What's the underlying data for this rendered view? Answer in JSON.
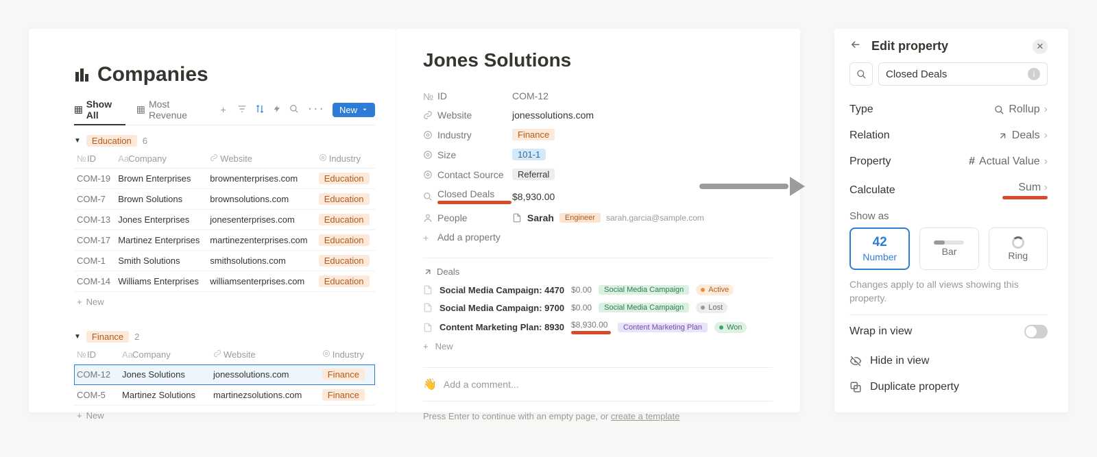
{
  "left": {
    "title": "Companies",
    "tabs": {
      "show_all": "Show All",
      "most_revenue": "Most Revenue",
      "new_btn": "New"
    },
    "columns": {
      "id": "ID",
      "company": "Company",
      "website": "Website",
      "industry": "Industry"
    },
    "groups": [
      {
        "name": "Education",
        "count": "6",
        "rows": [
          {
            "id": "COM-19",
            "company": "Brown Enterprises",
            "website": "brownenterprises.com",
            "industry": "Education"
          },
          {
            "id": "COM-7",
            "company": "Brown Solutions",
            "website": "brownsolutions.com",
            "industry": "Education"
          },
          {
            "id": "COM-13",
            "company": "Jones Enterprises",
            "website": "jonesenterprises.com",
            "industry": "Education"
          },
          {
            "id": "COM-17",
            "company": "Martinez Enterprises",
            "website": "martinezenterprises.com",
            "industry": "Education"
          },
          {
            "id": "COM-1",
            "company": "Smith Solutions",
            "website": "smithsolutions.com",
            "industry": "Education"
          },
          {
            "id": "COM-14",
            "company": "Williams Enterprises",
            "website": "williamsenterprises.com",
            "industry": "Education"
          }
        ]
      },
      {
        "name": "Finance",
        "count": "2",
        "rows": [
          {
            "id": "COM-12",
            "company": "Jones Solutions",
            "website": "jonessolutions.com",
            "industry": "Finance",
            "selected": true
          },
          {
            "id": "COM-5",
            "company": "Martinez Solutions",
            "website": "martinezsolutions.com",
            "industry": "Finance"
          }
        ]
      }
    ],
    "new_row": "New"
  },
  "mid": {
    "title": "Jones Solutions",
    "props": {
      "id_lbl": "ID",
      "id_val": "COM-12",
      "website_lbl": "Website",
      "website_val": "jonessolutions.com",
      "industry_lbl": "Industry",
      "industry_val": "Finance",
      "size_lbl": "Size",
      "size_val": "101-1",
      "source_lbl": "Contact Source",
      "source_val": "Referral",
      "closed_lbl": "Closed Deals",
      "closed_val": "$8,930.00",
      "people_lbl": "People",
      "people_name": "Sarah",
      "people_role": "Engineer",
      "people_email": "sarah.garcia@sample.com",
      "add_prop": "Add a property"
    },
    "deals_hdr": "Deals",
    "deals": [
      {
        "title": "Social Media Campaign: 4470",
        "amount": "$0.00",
        "cat": "Social Media Campaign",
        "status": "Active",
        "status_cls": "orange"
      },
      {
        "title": "Social Media Campaign: 9700",
        "amount": "$0.00",
        "cat": "Social Media Campaign",
        "status": "Lost",
        "status_cls": "grey"
      },
      {
        "title": "Content Marketing Plan: 8930",
        "amount": "$8,930.00",
        "cat": "Content Marketing Plan",
        "status": "Won",
        "status_cls": "green",
        "hl": true
      }
    ],
    "deals_new": "New",
    "comment": "Add a comment...",
    "hint_pre": "Press Enter to continue with an empty page, or ",
    "hint_link": "create a template"
  },
  "right": {
    "title": "Edit property",
    "search": "Closed Deals",
    "rows": {
      "type_lbl": "Type",
      "type_val": "Rollup",
      "relation_lbl": "Relation",
      "relation_val": "Deals",
      "property_lbl": "Property",
      "property_val": "Actual Value",
      "calc_lbl": "Calculate",
      "calc_val": "Sum"
    },
    "showas_lbl": "Show as",
    "showas": {
      "number_n": "42",
      "number": "Number",
      "bar": "Bar",
      "ring": "Ring"
    },
    "note": "Changes apply to all views showing this property.",
    "wrap": "Wrap in view",
    "hide": "Hide in view",
    "dup": "Duplicate property"
  }
}
